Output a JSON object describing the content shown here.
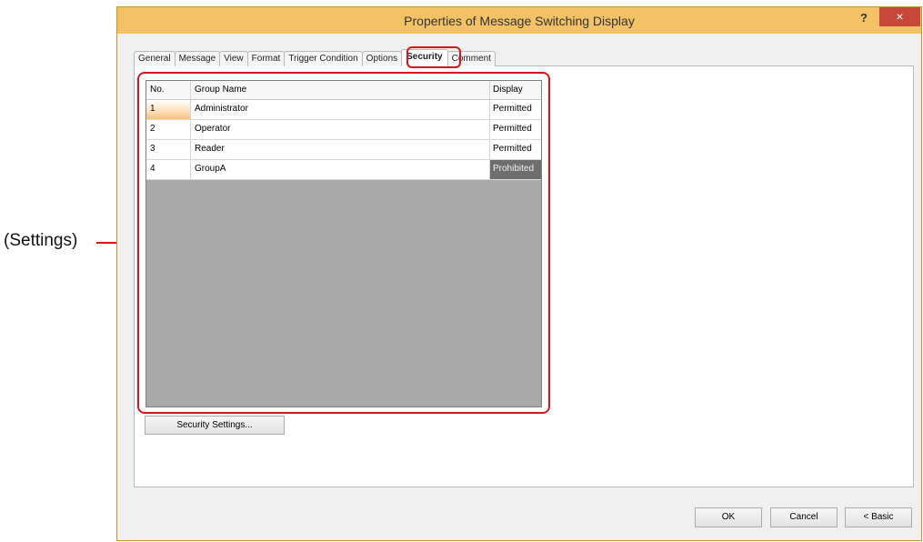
{
  "annotation": {
    "label": "(Settings)"
  },
  "dialog": {
    "title": "Properties of Message Switching Display",
    "help_label": "?",
    "close_label": "×"
  },
  "tabs": [
    {
      "label": "General"
    },
    {
      "label": "Message"
    },
    {
      "label": "View"
    },
    {
      "label": "Format"
    },
    {
      "label": "Trigger Condition"
    },
    {
      "label": "Options"
    },
    {
      "label": "Security"
    },
    {
      "label": "Comment"
    }
  ],
  "active_tab": "Security",
  "table": {
    "headers": {
      "no": "No.",
      "group_name": "Group Name",
      "display": "Display"
    },
    "rows": [
      {
        "no": "1",
        "group_name": "Administrator",
        "display": "Permitted"
      },
      {
        "no": "2",
        "group_name": "Operator",
        "display": "Permitted"
      },
      {
        "no": "3",
        "group_name": "Reader",
        "display": "Permitted"
      },
      {
        "no": "4",
        "group_name": "GroupA",
        "display": "Prohibited"
      }
    ]
  },
  "buttons": {
    "security_settings": "Security Settings...",
    "ok": "OK",
    "cancel": "Cancel",
    "basic": "< Basic"
  },
  "colors": {
    "titlebar": "#f4c266",
    "highlight": "#d8151b",
    "close": "#c7483b"
  }
}
